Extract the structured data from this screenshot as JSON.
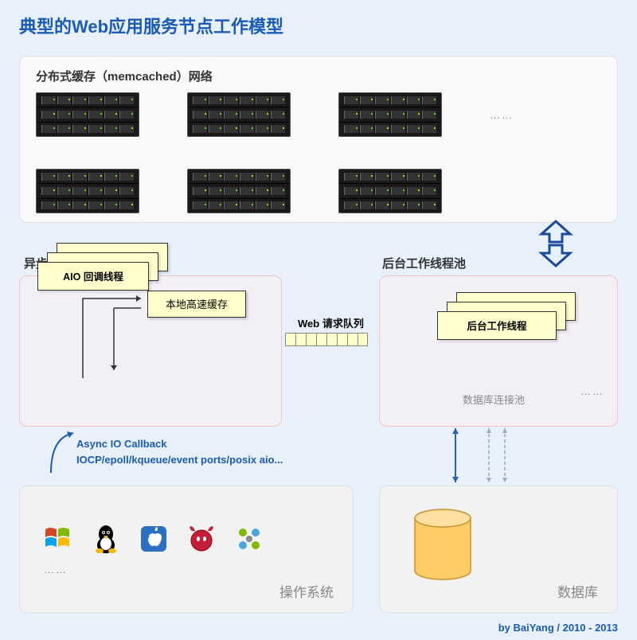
{
  "title": "典型的Web应用服务节点工作模型",
  "cache": {
    "label": "分布式缓存（memcached）网络",
    "ellipsis": "……"
  },
  "io": {
    "label": "异步 IO 回调线程池",
    "local_cache": "本地高速缓存",
    "aio_thread": "AIO 回调线程",
    "stack_ellipsis": "……"
  },
  "backend": {
    "label": "后台工作线程池",
    "worker_thread": "后台工作线程",
    "dbpool": "数据库连接池",
    "ellipsis": "……"
  },
  "queue": {
    "label": "Web 请求队列"
  },
  "callback": {
    "line1": "Async IO Callback",
    "line2": "IOCP/epoll/kqueue/event ports/posix aio..."
  },
  "os": {
    "label": "操作系统",
    "ellipsis": "……",
    "icons": [
      "windows",
      "linux-tux",
      "apple",
      "freebsd",
      "misc"
    ]
  },
  "db": {
    "label": "数据库"
  },
  "attribution": "by BaiYang / 2010 - 2013"
}
